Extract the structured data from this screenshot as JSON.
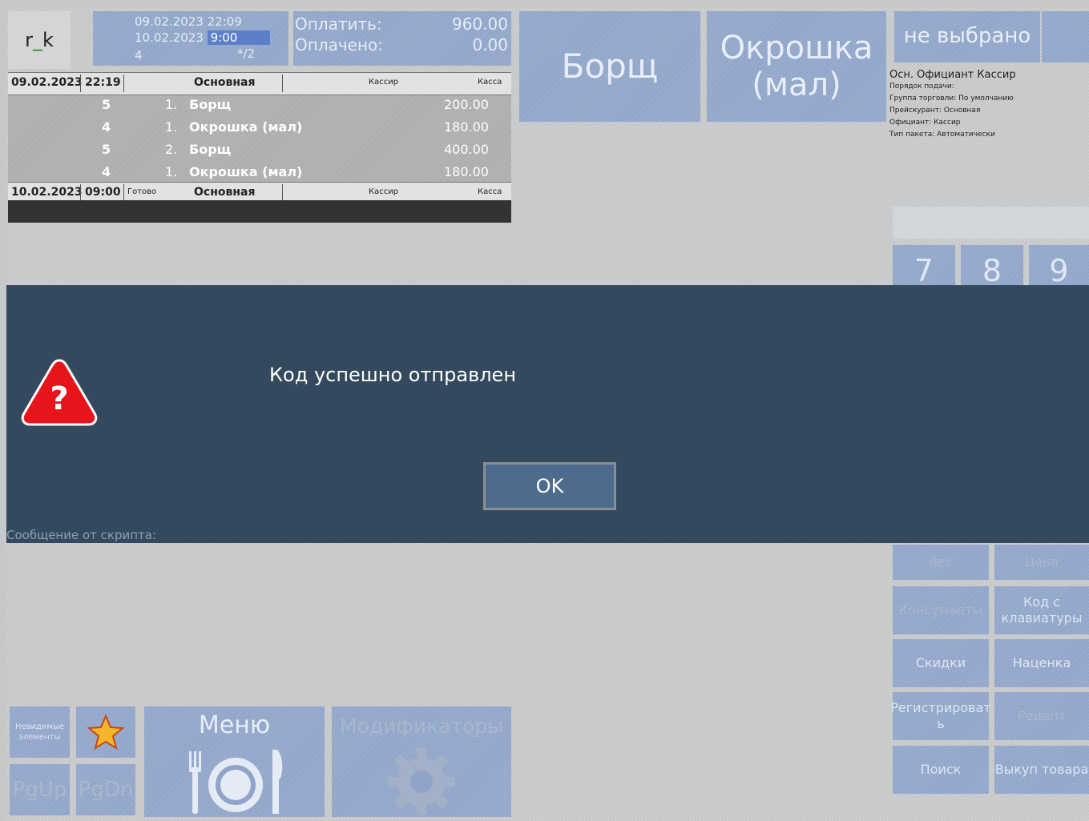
{
  "logo": {
    "prefix": "r",
    "underscore": "_",
    "suffix": "k"
  },
  "header": {
    "date1": "09.02.2023 22:09",
    "date2_prefix": "10.02.2023 ",
    "date2_time": "9:00",
    "guests": "4",
    "fraction": "*/2",
    "pay_label": "Оплатить:",
    "pay_value": "960.00",
    "paid_label": "Оплачено:",
    "paid_value": "0.00"
  },
  "order": {
    "header1": {
      "date": "09.02.2023",
      "time": "22:19",
      "status": "",
      "menu": "Основная",
      "waiter": "Кассир",
      "station": "Касса"
    },
    "items": [
      {
        "code": "5",
        "qty": "1.",
        "name": "Борщ",
        "price": "200.00"
      },
      {
        "code": "4",
        "qty": "1.",
        "name": "Окрошка (мал)",
        "price": "180.00"
      },
      {
        "code": "5",
        "qty": "2.",
        "name": "Борщ",
        "price": "400.00"
      },
      {
        "code": "4",
        "qty": "1.",
        "name": "Окрошка (мал)",
        "price": "180.00"
      }
    ],
    "header2": {
      "date": "10.02.2023",
      "time": "09:00",
      "status": "Готово",
      "menu": "Основная",
      "waiter": "Кассир",
      "station": "Касса"
    }
  },
  "dishes": {
    "borsch": "Борщ",
    "okroshka_line1": "Окрошка",
    "okroshka_line2": "(мал)"
  },
  "selector": {
    "not_selected": "не выбрано"
  },
  "info": {
    "line1": "Осн. Официант  Кассир",
    "line2": "Порядок подачи:",
    "line3": "Группа торговли: По умолчанию",
    "line4": "Прейскурант: Основная",
    "line5": "Официант: Кассир",
    "line6": "Тип пакета: Автоматически"
  },
  "numpad": [
    "7",
    "8",
    "9"
  ],
  "dialog": {
    "message": "Код успешно отправлен",
    "ok": "OK",
    "icon_glyph": "?",
    "script_label": "Сообщение от скрипта:"
  },
  "functions": {
    "weight": "Вес",
    "price": "Цена",
    "consumables": "Консуманты",
    "kbd_code_l1": "Код с",
    "kbd_code_l2": "клавиатуры",
    "discounts": "Скидки",
    "markup": "Наценка",
    "register_l1": "Регистрироват",
    "register_l2": "ь",
    "recipe": "Рецепт",
    "search": "Поиск",
    "buyback": "Выкуп товара"
  },
  "bottom": {
    "invisible_l1": "Невидимые",
    "invisible_l2": "элементы",
    "pgup": "PgUp",
    "pgdn": "PgDn",
    "menu": "Меню",
    "modifiers": "Модификаторы"
  },
  "colors": {
    "dialog_bg": "#34495e",
    "tile_blue": "#8fa4c8",
    "ok_button": "#4d6b8d",
    "warning_red": "#e8141b"
  }
}
